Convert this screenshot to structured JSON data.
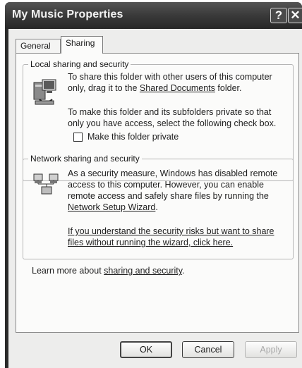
{
  "window": {
    "title": "My Music Properties",
    "help_glyph": "?",
    "close_glyph": "✕"
  },
  "tabs": [
    {
      "label": "General"
    },
    {
      "label": "Sharing"
    }
  ],
  "local": {
    "legend": "Local sharing and security",
    "line1": "To share this folder with other users of this computer",
    "line2_prefix": "only, drag it to the ",
    "shared_docs_link": "Shared Documents",
    "line2_suffix": " folder.",
    "private_line1": "To make this folder and its subfolders private so that",
    "private_line2": "only you have access, select the following check box.",
    "checkbox_label": "Make this folder private",
    "checkbox_checked": false
  },
  "network": {
    "legend": "Network sharing and security",
    "line1": "As a security measure, Windows has disabled remote",
    "line2": "access to this computer. However, you can enable",
    "line3": "remote access and safely share files by running the",
    "wizard_link": "Network Setup Wizard",
    "wizard_suffix": ".",
    "risk_link_line1": "If you understand the security risks but want to share",
    "risk_link_line2": "files without running the wizard, click here."
  },
  "learn_more": {
    "prefix": "Learn more about ",
    "link": "sharing and security",
    "suffix": "."
  },
  "buttons": {
    "ok": "OK",
    "cancel": "Cancel",
    "apply": "Apply"
  }
}
